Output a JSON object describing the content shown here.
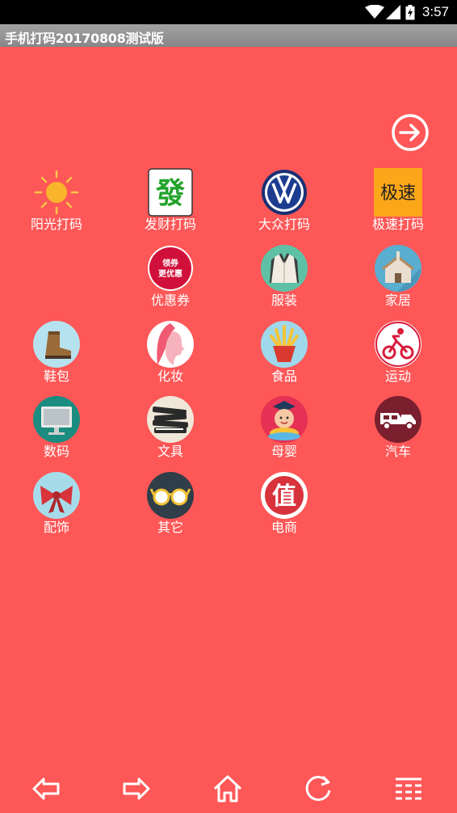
{
  "status": {
    "time": "3:57"
  },
  "app": {
    "title": "手机打码20170808测试版"
  },
  "rows": [
    [
      {
        "label": "阳光打码",
        "icon": "sun-icon"
      },
      {
        "label": "发财打码",
        "icon": "mahjong-fa-icon"
      },
      {
        "label": "大众打码",
        "icon": "volkswagen-logo-icon"
      },
      {
        "label": "极速打码",
        "icon": "jisu-tile-icon",
        "tile_text": "极速"
      }
    ],
    [
      {
        "label": "优惠券",
        "icon": "coupon-icon",
        "badge_line1": "领券",
        "badge_line2": "更优惠"
      },
      {
        "label": "服装",
        "icon": "jacket-icon"
      },
      {
        "label": "家居",
        "icon": "house-icon"
      }
    ],
    [
      {
        "label": "鞋包",
        "icon": "boot-icon"
      },
      {
        "label": "化妆",
        "icon": "woman-profile-icon"
      },
      {
        "label": "食品",
        "icon": "fries-icon"
      },
      {
        "label": "运动",
        "icon": "cyclist-icon"
      }
    ],
    [
      {
        "label": "数码",
        "icon": "monitor-icon"
      },
      {
        "label": "文具",
        "icon": "books-icon"
      },
      {
        "label": "母婴",
        "icon": "baby-icon"
      },
      {
        "label": "汽车",
        "icon": "tow-truck-icon"
      }
    ],
    [
      {
        "label": "配饰",
        "icon": "bow-icon"
      },
      {
        "label": "其它",
        "icon": "glasses-icon"
      },
      {
        "label": "电商",
        "icon": "zhi-seal-icon",
        "seal_text": "值"
      }
    ]
  ],
  "nav": [
    "back-arrow-icon",
    "forward-arrow-icon",
    "home-icon",
    "refresh-icon",
    "menu-icon"
  ],
  "colors": {
    "background": "#fe5757",
    "titlebar": "#999999",
    "statusbar": "#000000"
  }
}
